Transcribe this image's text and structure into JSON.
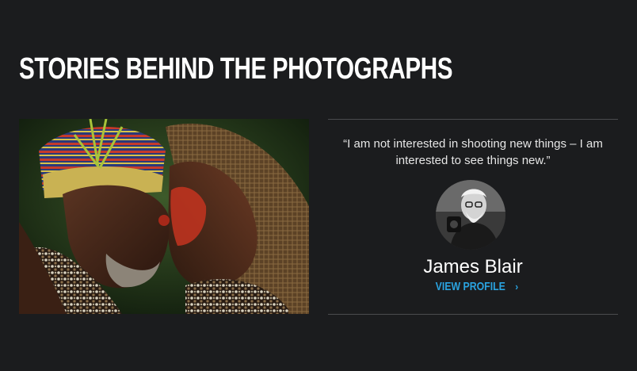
{
  "section": {
    "title": "STORIES BEHIND THE PHOTOGRAPHS"
  },
  "story": {
    "quote": "“I am not interested in shooting new things – I am interested to see things new.”",
    "author_name": "James Blair",
    "profile_link_label": "VIEW PROFILE",
    "profile_link_icon": "chevron-right-icon"
  },
  "colors": {
    "background": "#1b1c1e",
    "link_accent": "#2aa3e0",
    "divider": "#4a4b4e"
  }
}
